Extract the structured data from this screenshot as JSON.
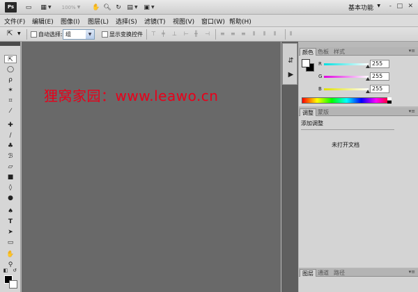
{
  "appbar": {
    "logo": "Ps",
    "zoom": "100%",
    "workspace": "基本功能",
    "window_controls": [
      "-",
      "□",
      "✕"
    ]
  },
  "menu": [
    {
      "label": "文件(F)"
    },
    {
      "label": "编辑(E)"
    },
    {
      "label": "图像(I)"
    },
    {
      "label": "图层(L)"
    },
    {
      "label": "选择(S)"
    },
    {
      "label": "滤镜(T)"
    },
    {
      "label": "视图(V)"
    },
    {
      "label": "窗口(W)"
    },
    {
      "label": "帮助(H)"
    }
  ],
  "options": {
    "auto_select_label": "自动选择:",
    "auto_select_value": "组",
    "show_transform_label": "显示变换控件"
  },
  "canvas": {
    "watermark": "狸窝家园：www.leawo.cn"
  },
  "color_panel": {
    "tabs": [
      "颜色",
      "色板",
      "样式"
    ],
    "channels": [
      {
        "label": "R",
        "value": "255",
        "color": "#00e0e0"
      },
      {
        "label": "G",
        "value": "255",
        "color": "#e000e0"
      },
      {
        "label": "B",
        "value": "255",
        "color": "#e0e000"
      }
    ]
  },
  "adjust_panel": {
    "tabs": [
      "调整",
      "蒙版"
    ],
    "title": "添加调整",
    "empty_text": "未打开文档"
  },
  "layers_panel": {
    "tabs": [
      "图层",
      "通道",
      "路径"
    ]
  }
}
